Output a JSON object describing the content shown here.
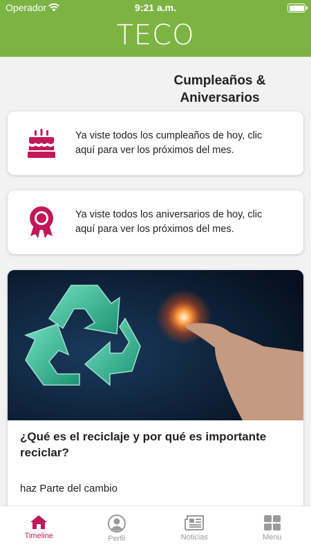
{
  "status_bar": {
    "carrier": "Operador",
    "time": "9:21 a.m."
  },
  "header": {
    "logo": "TECO"
  },
  "section": {
    "title": "Cumpleaños & Aniversarios"
  },
  "birthday_card": {
    "icon": "birthday-cake-icon",
    "text": "Ya viste todos los cumpleaños de hoy, clic aquí para ver los próximos del mes."
  },
  "anniversary_card": {
    "icon": "award-ribbon-icon",
    "text": "Ya viste todos los aniversarios de hoy, clic aquí para ver los próximos del mes."
  },
  "news": {
    "title": "¿Qué es el reciclaje y por qué es importante reciclar?",
    "subtitle": "haz Parte del cambio"
  },
  "tabbar": {
    "items": [
      {
        "label": "Timeline",
        "icon": "home-icon",
        "active": true
      },
      {
        "label": "Perfil",
        "icon": "profile-icon",
        "active": false
      },
      {
        "label": "Noticias",
        "icon": "newspaper-icon",
        "active": false
      },
      {
        "label": "Menu",
        "icon": "grid-icon",
        "active": false
      }
    ]
  },
  "colors": {
    "header": "#7cb342",
    "accent": "#c2185b",
    "inactive": "#9a9a9a"
  }
}
